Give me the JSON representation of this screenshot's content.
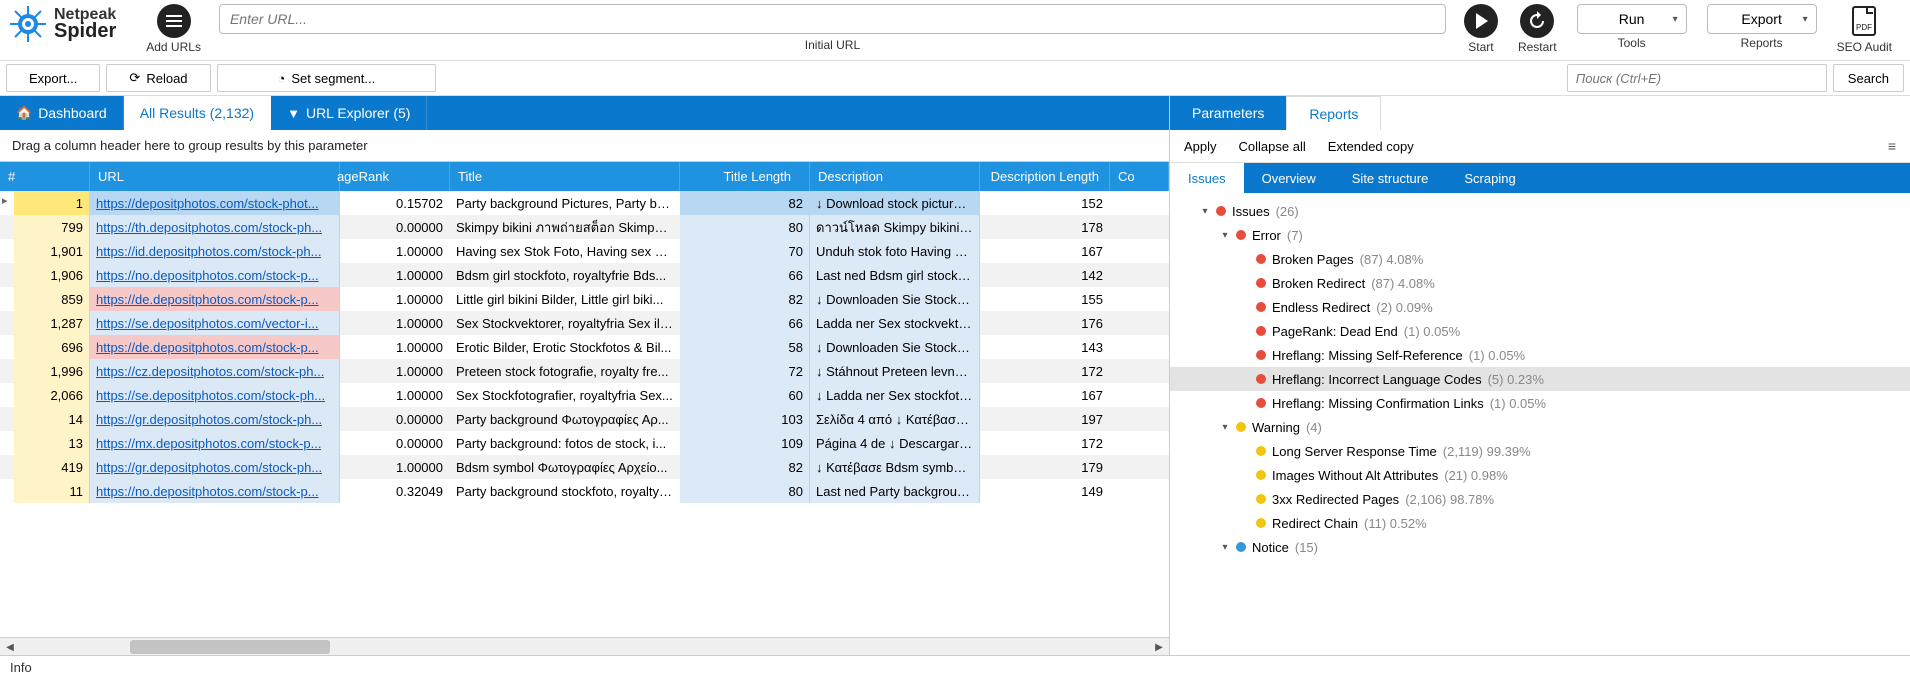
{
  "logo": {
    "line1": "Netpeak",
    "line2": "Spider"
  },
  "toolbar": {
    "add_urls": "Add URLs",
    "url_placeholder": "Enter URL...",
    "url_caption": "Initial URL",
    "start": "Start",
    "restart": "Restart",
    "run": "Run",
    "tools": "Tools",
    "export": "Export",
    "reports": "Reports",
    "seo_audit": "SEO Audit",
    "pdf": "PDF"
  },
  "secondbar": {
    "export": "Export...",
    "reload": "Reload",
    "set_segment": "Set segment...",
    "search_placeholder": "Поиск (Ctrl+E)",
    "search_btn": "Search"
  },
  "main_tabs": {
    "dashboard": "Dashboard",
    "all_results": "All Results (2,132)",
    "url_explorer": "URL Explorer (5)"
  },
  "group_hint": "Drag a column header here to group results by this parameter",
  "columns": {
    "idx": "#",
    "url": "URL",
    "pagerank": "ageRank",
    "title": "Title",
    "title_len": "Title Length",
    "description": "Description",
    "desc_len": "Description Length",
    "co": "Со"
  },
  "rows": [
    {
      "idx": "1",
      "url": "https://depositphotos.com/stock-phot...",
      "pr": "0.15702",
      "title": "Party background Pictures, Party ba...",
      "tlen": "82",
      "desc": "↓ Download stock pictures...",
      "dlen": "152",
      "sel": true,
      "hot": false
    },
    {
      "idx": "799",
      "url": "https://th.depositphotos.com/stock-ph...",
      "pr": "0.00000",
      "title": "Skimpy bikini ภาพถ่ายสต็อก Skimpy b...",
      "tlen": "80",
      "desc": "ดาวน์โหลด Skimpy bikini ภา...",
      "dlen": "178",
      "hot": false
    },
    {
      "idx": "1,901",
      "url": "https://id.depositphotos.com/stock-ph...",
      "pr": "1.00000",
      "title": "Having sex Stok Foto, Having sex Ga...",
      "tlen": "70",
      "desc": "Unduh stok foto Having se...",
      "dlen": "167",
      "hot": false
    },
    {
      "idx": "1,906",
      "url": "https://no.depositphotos.com/stock-p...",
      "pr": "1.00000",
      "title": "Bdsm girl stockfoto, royaltyfrie Bds...",
      "tlen": "66",
      "desc": "Last ned Bdsm girl stockfot...",
      "dlen": "142",
      "hot": false
    },
    {
      "idx": "859",
      "url": "https://de.depositphotos.com/stock-p...",
      "pr": "1.00000",
      "title": "Little girl bikini Bilder, Little girl biki...",
      "tlen": "82",
      "desc": "↓ Downloaden Sie Stockfot...",
      "dlen": "155",
      "hot": true
    },
    {
      "idx": "1,287",
      "url": "https://se.depositphotos.com/vector-i...",
      "pr": "1.00000",
      "title": "Sex Stockvektorer, royaltyfria Sex ill...",
      "tlen": "66",
      "desc": "Ladda ner Sex stockvektore...",
      "dlen": "176",
      "hot": false
    },
    {
      "idx": "696",
      "url": "https://de.depositphotos.com/stock-p...",
      "pr": "1.00000",
      "title": "Erotic Bilder, Erotic Stockfotos & Bil...",
      "tlen": "58",
      "desc": "↓ Downloaden Sie Stockfot...",
      "dlen": "143",
      "hot": true
    },
    {
      "idx": "1,996",
      "url": "https://cz.depositphotos.com/stock-ph...",
      "pr": "1.00000",
      "title": "Preteen stock fotografie, royalty fre...",
      "tlen": "72",
      "desc": "↓ Stáhnout Preteen levné f...",
      "dlen": "172",
      "hot": false
    },
    {
      "idx": "2,066",
      "url": "https://se.depositphotos.com/stock-ph...",
      "pr": "1.00000",
      "title": "Sex Stockfotografier, royaltyfria Sex...",
      "tlen": "60",
      "desc": "↓ Ladda ner Sex stockfotog...",
      "dlen": "167",
      "hot": false
    },
    {
      "idx": "14",
      "url": "https://gr.depositphotos.com/stock-ph...",
      "pr": "0.00000",
      "title": "Party background Φωτογραφίες Αρ...",
      "tlen": "103",
      "desc": "Σελίδα 4 από ↓ Κατέβασε P...",
      "dlen": "197",
      "hot": false
    },
    {
      "idx": "13",
      "url": "https://mx.depositphotos.com/stock-p...",
      "pr": "0.00000",
      "title": "Party background: fotos de stock, i...",
      "tlen": "109",
      "desc": "Página 4 de ↓ Descargar im...",
      "dlen": "172",
      "hot": false
    },
    {
      "idx": "419",
      "url": "https://gr.depositphotos.com/stock-ph...",
      "pr": "1.00000",
      "title": "Bdsm symbol Φωτογραφίες Αρχείο...",
      "tlen": "82",
      "desc": "↓ Κατέβασε Bdsm symbol...",
      "dlen": "179",
      "hot": false
    },
    {
      "idx": "11",
      "url": "https://no.depositphotos.com/stock-p...",
      "pr": "0.32049",
      "title": "Party background stockfoto, royaltyf...",
      "tlen": "80",
      "desc": "Last ned Party background...",
      "dlen": "149",
      "hot": false
    }
  ],
  "right": {
    "tabs": {
      "parameters": "Parameters",
      "reports": "Reports"
    },
    "actions": {
      "apply": "Apply",
      "collapse": "Collapse all",
      "extended": "Extended copy"
    },
    "subtabs": {
      "issues": "Issues",
      "overview": "Overview",
      "site_structure": "Site structure",
      "scraping": "Scraping"
    }
  },
  "tree": [
    {
      "lvl": 1,
      "caret": "▾",
      "dot": "red",
      "label": "Issues",
      "count": "(26)"
    },
    {
      "lvl": 2,
      "caret": "▾",
      "dot": "red",
      "label": "Error",
      "count": "(7)"
    },
    {
      "lvl": 3,
      "dot": "red",
      "label": "Broken Pages",
      "count": "(87) 4.08%"
    },
    {
      "lvl": 3,
      "dot": "red",
      "label": "Broken Redirect",
      "count": "(87) 4.08%"
    },
    {
      "lvl": 3,
      "dot": "red",
      "label": "Endless Redirect",
      "count": "(2) 0.09%"
    },
    {
      "lvl": 3,
      "dot": "red",
      "label": "PageRank: Dead End",
      "count": "(1) 0.05%"
    },
    {
      "lvl": 3,
      "dot": "red",
      "label": "Hreflang: Missing Self-Reference",
      "count": "(1) 0.05%"
    },
    {
      "lvl": 3,
      "dot": "red",
      "label": "Hreflang: Incorrect Language Codes",
      "count": "(5) 0.23%",
      "sel": true
    },
    {
      "lvl": 3,
      "dot": "red",
      "label": "Hreflang: Missing Confirmation Links",
      "count": "(1) 0.05%"
    },
    {
      "lvl": 2,
      "caret": "▾",
      "dot": "yel",
      "label": "Warning",
      "count": "(4)"
    },
    {
      "lvl": 3,
      "dot": "yel",
      "label": "Long Server Response Time",
      "count": "(2,119) 99.39%"
    },
    {
      "lvl": 3,
      "dot": "yel",
      "label": "Images Without Alt Attributes",
      "count": "(21) 0.98%"
    },
    {
      "lvl": 3,
      "dot": "yel",
      "label": "3xx Redirected Pages",
      "count": "(2,106) 98.78%"
    },
    {
      "lvl": 3,
      "dot": "yel",
      "label": "Redirect Chain",
      "count": "(11) 0.52%"
    },
    {
      "lvl": 2,
      "caret": "▾",
      "dot": "blu",
      "label": "Notice",
      "count": "(15)"
    }
  ],
  "status": "Info"
}
